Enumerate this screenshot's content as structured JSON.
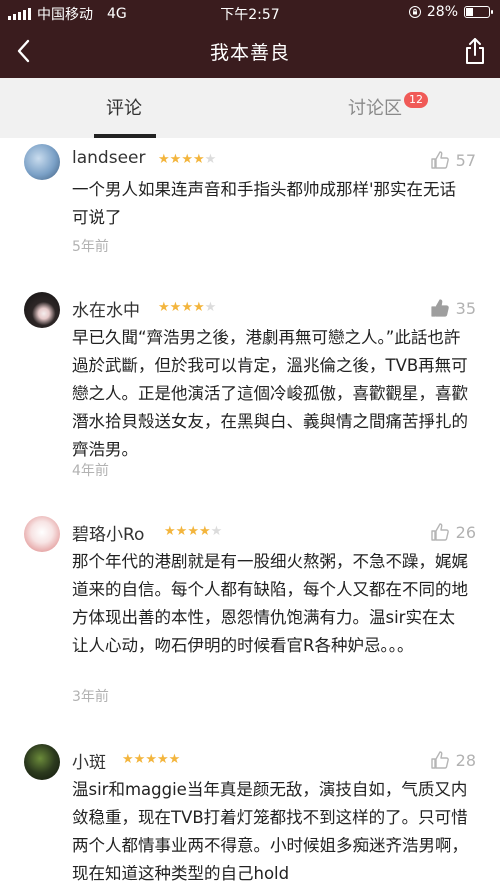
{
  "status_bar": {
    "carrier": "中国移动",
    "network": "4G",
    "time": "下午2:57",
    "battery": "28%",
    "battery_level": 0.28
  },
  "nav": {
    "title": "我本善良",
    "back_icon": "chevron-left-icon",
    "share_icon": "share-icon"
  },
  "tabs": [
    {
      "label": "评论",
      "active": true
    },
    {
      "label": "讨论区",
      "active": false,
      "badge": "12"
    }
  ],
  "reviews": [
    {
      "user": "landseer",
      "rating": 4,
      "likes": "57",
      "liked": false,
      "text": "一个男人如果连声音和手指头都帅成那样'那实在无话可说了",
      "time": "5年前",
      "colors": {
        "avatar": "#7aa0c6"
      }
    },
    {
      "user": "水在水中",
      "rating": 4,
      "likes": "35",
      "liked": true,
      "text": "早已久聞“齊浩男之後，港劇再無可戀之人。”此話也許過於武斷，但於我可以肯定，溫兆倫之後，TVB再無可戀之人。正是他演活了這個冷峻孤傲，喜歡觀星，喜歡潛水拾貝殼送女友，在黑與白、義與情之間痛苦掙扎的齊浩男。",
      "time": "4年前",
      "colors": {
        "avatar": "#2d2626"
      }
    },
    {
      "user": "碧珞小Ro",
      "rating": 4,
      "likes": "26",
      "liked": false,
      "text": "那个年代的港剧就是有一股细火熬粥，不急不躁，娓娓道来的自信。每个人都有缺陷，每个人又都在不同的地方体现出善的本性，恩怨情仇饱满有力。温sir实在太让人心动，吻石伊明的时候看官R各种妒忌。。。",
      "time": "3年前",
      "colors": {
        "avatar": "#f3d8d8"
      }
    },
    {
      "user": "小斑",
      "rating": 5,
      "likes": "28",
      "liked": false,
      "text": "温sir和maggie当年真是颜无敌，演技自如，气质又内敛稳重，现在TVB打着灯笼都找不到这样的了。只可惜两个人都情事业两不得意。小时候姐多痴迷齐浩男啊，现在知道这种类型的自己hold",
      "time": "",
      "colors": {
        "avatar": "#2c3a1e"
      }
    }
  ]
}
